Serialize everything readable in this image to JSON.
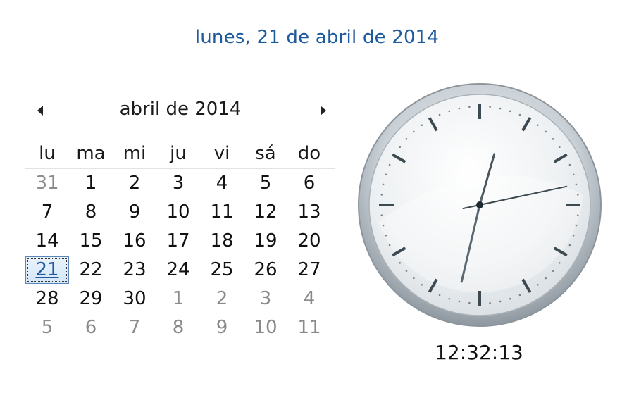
{
  "header": {
    "full_date": "lunes, 21 de abril de 2014"
  },
  "calendar": {
    "month_title": "abril de 2014",
    "prev_icon": "triangle-left-icon",
    "next_icon": "triangle-right-icon",
    "weekdays": [
      "lu",
      "ma",
      "mi",
      "ju",
      "vi",
      "sá",
      "do"
    ],
    "weeks": [
      [
        {
          "d": "31",
          "other": true
        },
        {
          "d": "1"
        },
        {
          "d": "2"
        },
        {
          "d": "3"
        },
        {
          "d": "4"
        },
        {
          "d": "5"
        },
        {
          "d": "6"
        }
      ],
      [
        {
          "d": "7"
        },
        {
          "d": "8"
        },
        {
          "d": "9"
        },
        {
          "d": "10"
        },
        {
          "d": "11"
        },
        {
          "d": "12"
        },
        {
          "d": "13"
        }
      ],
      [
        {
          "d": "14"
        },
        {
          "d": "15"
        },
        {
          "d": "16"
        },
        {
          "d": "17"
        },
        {
          "d": "18"
        },
        {
          "d": "19"
        },
        {
          "d": "20"
        }
      ],
      [
        {
          "d": "21",
          "today": true
        },
        {
          "d": "22"
        },
        {
          "d": "23"
        },
        {
          "d": "24"
        },
        {
          "d": "25"
        },
        {
          "d": "26"
        },
        {
          "d": "27"
        }
      ],
      [
        {
          "d": "28"
        },
        {
          "d": "29"
        },
        {
          "d": "30"
        },
        {
          "d": "1",
          "other": true
        },
        {
          "d": "2",
          "other": true
        },
        {
          "d": "3",
          "other": true
        },
        {
          "d": "4",
          "other": true
        }
      ],
      [
        {
          "d": "5",
          "other": true
        },
        {
          "d": "6",
          "other": true
        },
        {
          "d": "7",
          "other": true
        },
        {
          "d": "8",
          "other": true
        },
        {
          "d": "9",
          "other": true
        },
        {
          "d": "10",
          "other": true
        },
        {
          "d": "11",
          "other": true
        }
      ]
    ]
  },
  "clock": {
    "digital_time": "12:32:13",
    "hour": 12,
    "minute": 32,
    "second": 13,
    "face_icon": "analog-clock-icon"
  },
  "colors": {
    "accent": "#1e5a9e",
    "other_month_text": "#8a8a8a"
  }
}
